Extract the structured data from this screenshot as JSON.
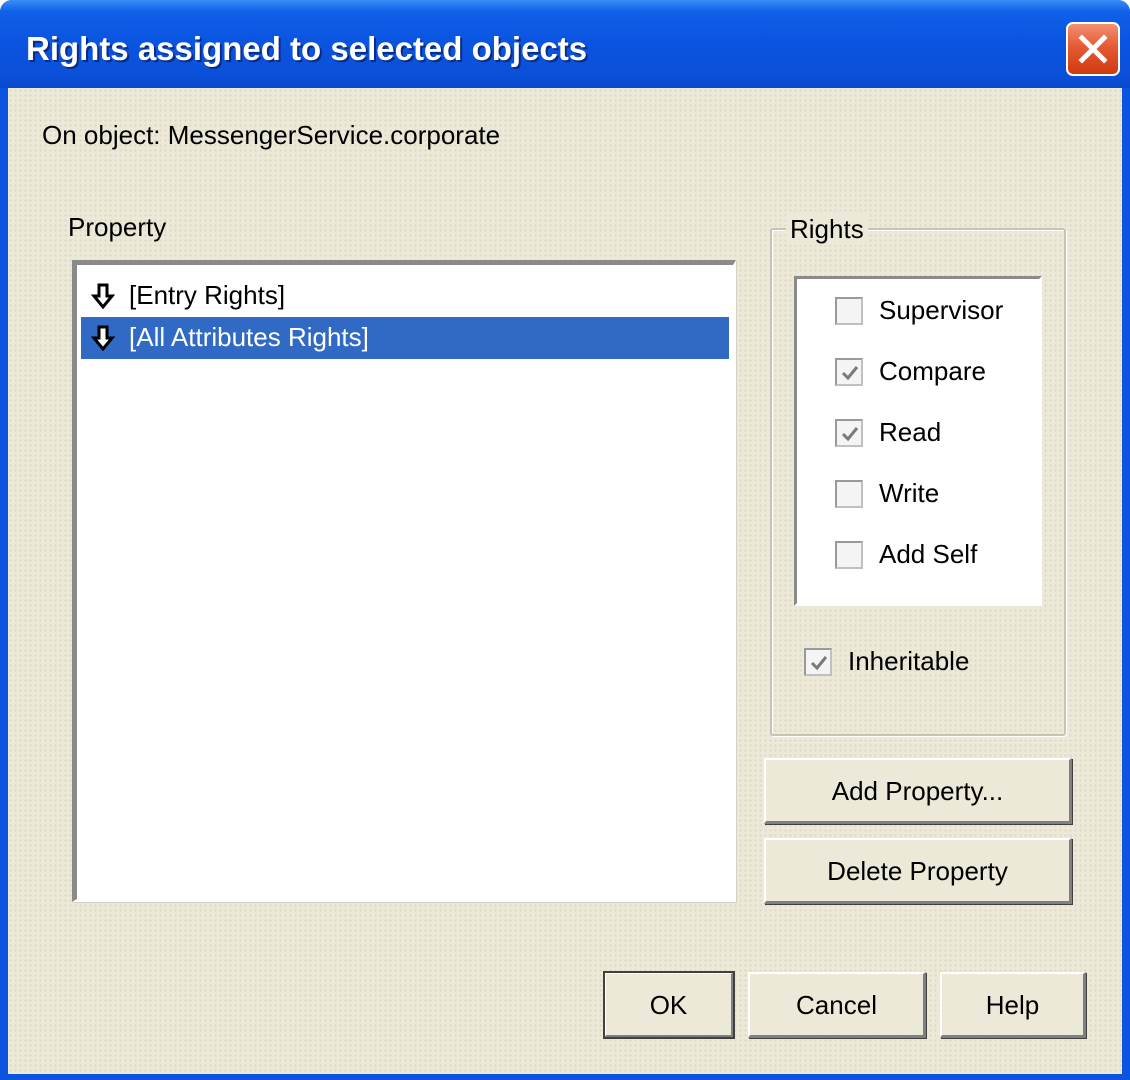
{
  "dialog": {
    "title": "Rights assigned to selected objects",
    "close_icon": "close-icon"
  },
  "object_line": "On object: MessengerService.corporate",
  "property": {
    "label": "Property",
    "items": [
      {
        "icon": "down-arrow-icon",
        "label": "[Entry Rights]",
        "selected": false
      },
      {
        "icon": "down-arrow-icon",
        "label": "[All Attributes Rights]",
        "selected": true
      }
    ]
  },
  "rights": {
    "legend": "Rights",
    "options": [
      {
        "label": "Supervisor",
        "checked": false
      },
      {
        "label": "Compare",
        "checked": true
      },
      {
        "label": "Read",
        "checked": true
      },
      {
        "label": "Write",
        "checked": false
      },
      {
        "label": "Add Self",
        "checked": false
      }
    ],
    "inheritable": {
      "label": "Inheritable",
      "checked": true
    }
  },
  "buttons": {
    "add_property": "Add Property...",
    "delete_property": "Delete Property",
    "ok": "OK",
    "cancel": "Cancel",
    "help": "Help"
  },
  "colors": {
    "titlebar": "#0a54e0",
    "selection": "#316ac5",
    "face": "#ece9d8",
    "close": "#e55a32"
  }
}
